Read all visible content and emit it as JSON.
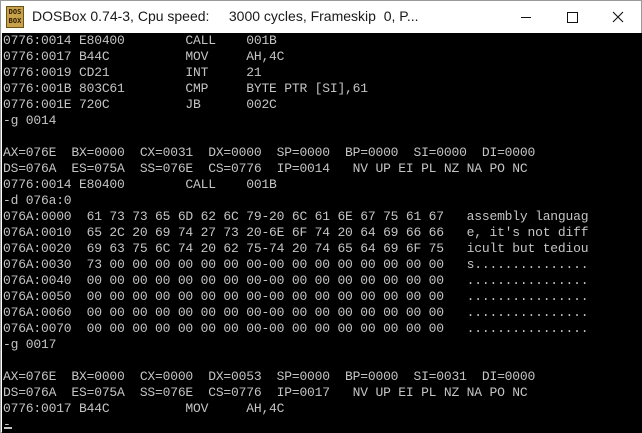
{
  "window": {
    "title": "DOSBox 0.74-3, Cpu speed:     3000 cycles, Frameskip  0, P...",
    "icon_text_top": "DOS",
    "icon_text_bottom": "BOX"
  },
  "icons": {
    "app": "dosbox-icon",
    "minimize": "minimize-icon",
    "maximize": "maximize-icon",
    "close": "close-icon"
  },
  "terminal": {
    "lines": [
      "0776:0014 E80400        CALL    001B",
      "0776:0017 B44C          MOV     AH,4C",
      "0776:0019 CD21          INT     21",
      "0776:001B 803C61        CMP     BYTE PTR [SI],61",
      "0776:001E 720C          JB      002C",
      "-g 0014",
      "",
      "AX=076E  BX=0000  CX=0031  DX=0000  SP=0000  BP=0000  SI=0000  DI=0000",
      "DS=076A  ES=075A  SS=076E  CS=0776  IP=0014   NV UP EI PL NZ NA PO NC",
      "0776:0014 E80400        CALL    001B",
      "-d 076a:0",
      "076A:0000  61 73 73 65 6D 62 6C 79-20 6C 61 6E 67 75 61 67   assembly languag",
      "076A:0010  65 2C 20 69 74 27 73 20-6E 6F 74 20 64 69 66 66   e, it's not diff",
      "076A:0020  69 63 75 6C 74 20 62 75-74 20 74 65 64 69 6F 75   icult but tediou",
      "076A:0030  73 00 00 00 00 00 00 00-00 00 00 00 00 00 00 00   s...............",
      "076A:0040  00 00 00 00 00 00 00 00-00 00 00 00 00 00 00 00   ................",
      "076A:0050  00 00 00 00 00 00 00 00-00 00 00 00 00 00 00 00   ................",
      "076A:0060  00 00 00 00 00 00 00 00-00 00 00 00 00 00 00 00   ................",
      "076A:0070  00 00 00 00 00 00 00 00-00 00 00 00 00 00 00 00   ................",
      "-g 0017",
      "",
      "AX=076E  BX=0000  CX=0000  DX=0053  SP=0000  BP=0000  SI=0031  DI=0000",
      "DS=076A  ES=075A  SS=076E  CS=0776  IP=0017   NV UP EI PL NZ NA PO NC",
      "0776:0017 B44C          MOV     AH,4C",
      "-"
    ]
  }
}
